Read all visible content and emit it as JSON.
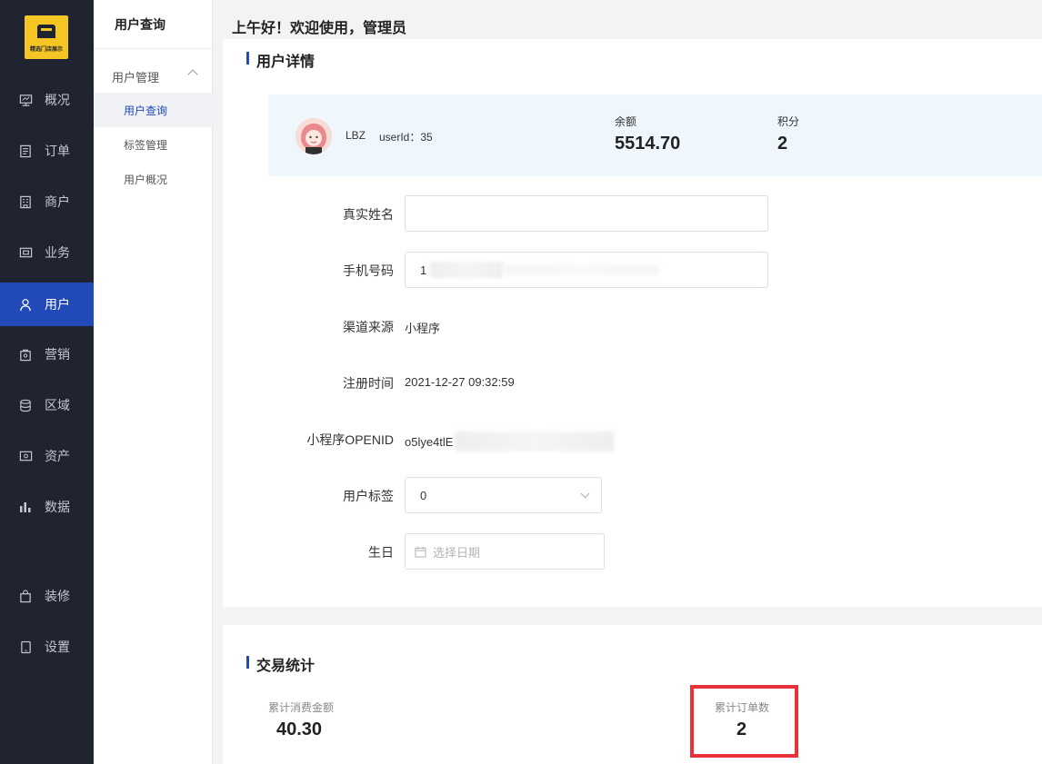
{
  "logo": {
    "text": "精选门店展示"
  },
  "nav": {
    "items": [
      {
        "label": "概况",
        "icon": "monitor-icon"
      },
      {
        "label": "订单",
        "icon": "document-icon"
      },
      {
        "label": "商户",
        "icon": "store-icon"
      },
      {
        "label": "业务",
        "icon": "briefcase-icon"
      },
      {
        "label": "用户",
        "icon": "user-icon"
      },
      {
        "label": "营销",
        "icon": "bag-icon"
      },
      {
        "label": "区域",
        "icon": "database-icon"
      },
      {
        "label": "资产",
        "icon": "wallet-icon"
      },
      {
        "label": "数据",
        "icon": "bar-chart-icon"
      },
      {
        "label": "装修",
        "icon": "shopping-bag-icon"
      },
      {
        "label": "设置",
        "icon": "tablet-icon"
      }
    ],
    "active_index": 4
  },
  "subnav": {
    "title": "用户查询",
    "group_label": "用户管理",
    "items": [
      "用户查询",
      "标签管理",
      "用户概况"
    ],
    "active_index": 0
  },
  "header": {
    "greeting": "上午好！欢迎使用，管理员"
  },
  "user_detail": {
    "section_title": "用户详情",
    "name": "LBZ",
    "user_id": "userId：35",
    "balance_label": "余额",
    "balance_value": "5514.70",
    "points_label": "积分",
    "points_value": "2"
  },
  "form": {
    "real_name_label": "真实姓名",
    "real_name_value": "",
    "phone_label": "手机号码",
    "phone_value": "1",
    "channel_label": "渠道来源",
    "channel_value": "小程序",
    "register_time_label": "注册时间",
    "register_time_value": "2021-12-27 09:32:59",
    "openid_label": "小程序OPENID",
    "openid_value": "o5lye4tlE",
    "tag_label": "用户标签",
    "tag_value": "0",
    "birthday_label": "生日",
    "birthday_placeholder": "选择日期"
  },
  "trade_stats": {
    "section_title": "交易统计",
    "total_spend_label": "累计消费金额",
    "total_spend_value": "40.30",
    "total_orders_label": "累计订单数",
    "total_orders_value": "2"
  },
  "colors": {
    "accent": "#2149b8",
    "nav_bg": "#1f2430",
    "highlight": "#e8323a",
    "logo": "#f5c524"
  }
}
